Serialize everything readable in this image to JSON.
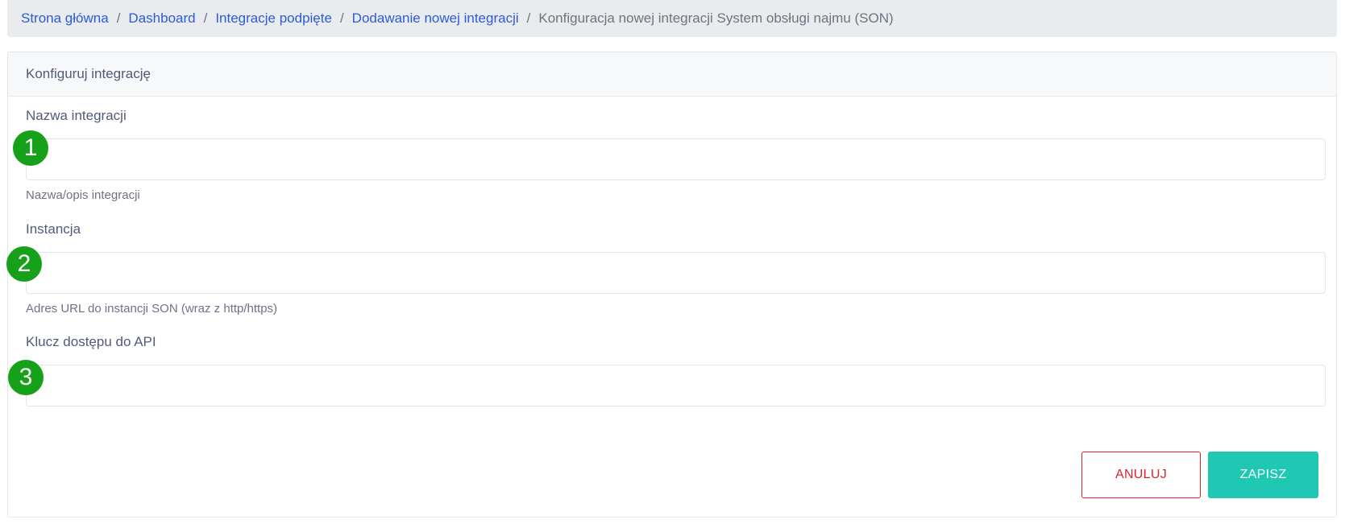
{
  "breadcrumb": {
    "items": [
      "Strona główna",
      "Dashboard",
      "Integracje podpięte",
      "Dodawanie nowej integracji"
    ],
    "separator": "/",
    "current": "Konfiguracja nowej integracji System obsługi najmu (SON)"
  },
  "card": {
    "header": "Konfiguruj integrację",
    "fields": [
      {
        "label": "Nazwa integracji",
        "value": "",
        "help": "Nazwa/opis integracji",
        "marker": "1"
      },
      {
        "label": "Instancja",
        "value": "",
        "help": "Adres URL do instancji SON (wraz z http/https)",
        "marker": "2"
      },
      {
        "label": "Klucz dostępu do API",
        "value": "",
        "help": "",
        "marker": "3"
      }
    ]
  },
  "actions": {
    "cancel_label": "ANULUJ",
    "save_label": "ZAPISZ"
  },
  "colors": {
    "link": "#2d5ad9",
    "marker": "#17a11b",
    "cancel": "#d9252a",
    "save": "#1fc8b3"
  }
}
